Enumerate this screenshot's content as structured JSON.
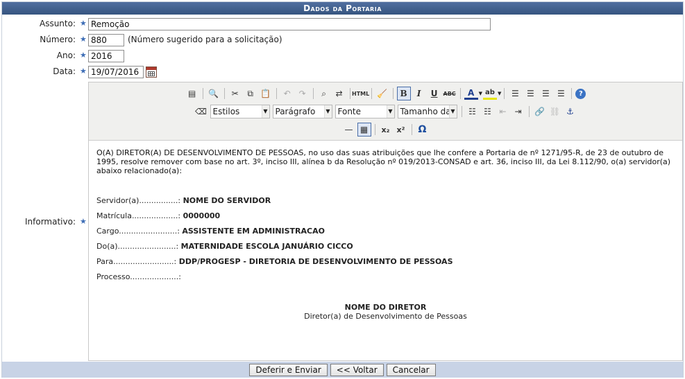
{
  "header": {
    "title": "Dados da Portaria"
  },
  "form": {
    "assunto": {
      "label": "Assunto:",
      "value": "Remoção"
    },
    "numero": {
      "label": "Número:",
      "value": "880",
      "hint": "(Número sugerido para a solicitação)"
    },
    "ano": {
      "label": "Ano:",
      "value": "2016"
    },
    "data": {
      "label": "Data:",
      "value": "19/07/2016"
    },
    "informativo": {
      "label": "Informativo:"
    },
    "required_mark": "★"
  },
  "editor": {
    "toolbar": {
      "estilos": "Estilos",
      "paragrafo": "Parágrafo",
      "fonte": "Fonte",
      "tamanho": "Tamanho da Fonte",
      "html_label": "HTML",
      "bold": "B",
      "italic": "I",
      "underline": "U",
      "strike": "ABC",
      "subscript": "x₂",
      "superscript": "x²",
      "omega": "Ω"
    },
    "body": {
      "paragraph": "O(A) DIRETOR(A) DE DESENVOLVIMENTO DE PESSOAS, no uso das suas atribuições que lhe confere a Portaria de nº 1271/95-R, de 23 de outubro de 1995, resolve remover com base no art. 3º, inciso III, alínea b da Resolução nº 019/2013-CONSAD e art. 36, inciso III, da Lei 8.112/90, o(a) servidor(a) abaixo relacionado(a):",
      "fields": [
        {
          "label": "Servidor(a)................:",
          "value": "NOME DO SERVIDOR"
        },
        {
          "label": "Matrícula...................:",
          "value": "0000000"
        },
        {
          "label": "Cargo........................:",
          "value": "ASSISTENTE EM ADMINISTRACAO"
        },
        {
          "label": "Do(a)........................:",
          "value": "MATERNIDADE ESCOLA JANUÁRIO CICCO"
        },
        {
          "label": "Para.........................:",
          "value": "DDP/PROGESP - DIRETORIA DE DESENVOLVIMENTO DE PESSOAS"
        },
        {
          "label": "Processo....................:",
          "value": ""
        }
      ],
      "signature_name": "NOME DO DIRETOR",
      "signature_role": "Diretor(a) de Desenvolvimento de Pessoas"
    }
  },
  "footer": {
    "deferir": "Deferir e Enviar",
    "voltar": "<< Voltar",
    "cancelar": "Cancelar"
  },
  "colors": {
    "title_bar": "#3f5f8f",
    "footer_bar": "#c8d3e6",
    "required_star": "#3d6db5"
  }
}
